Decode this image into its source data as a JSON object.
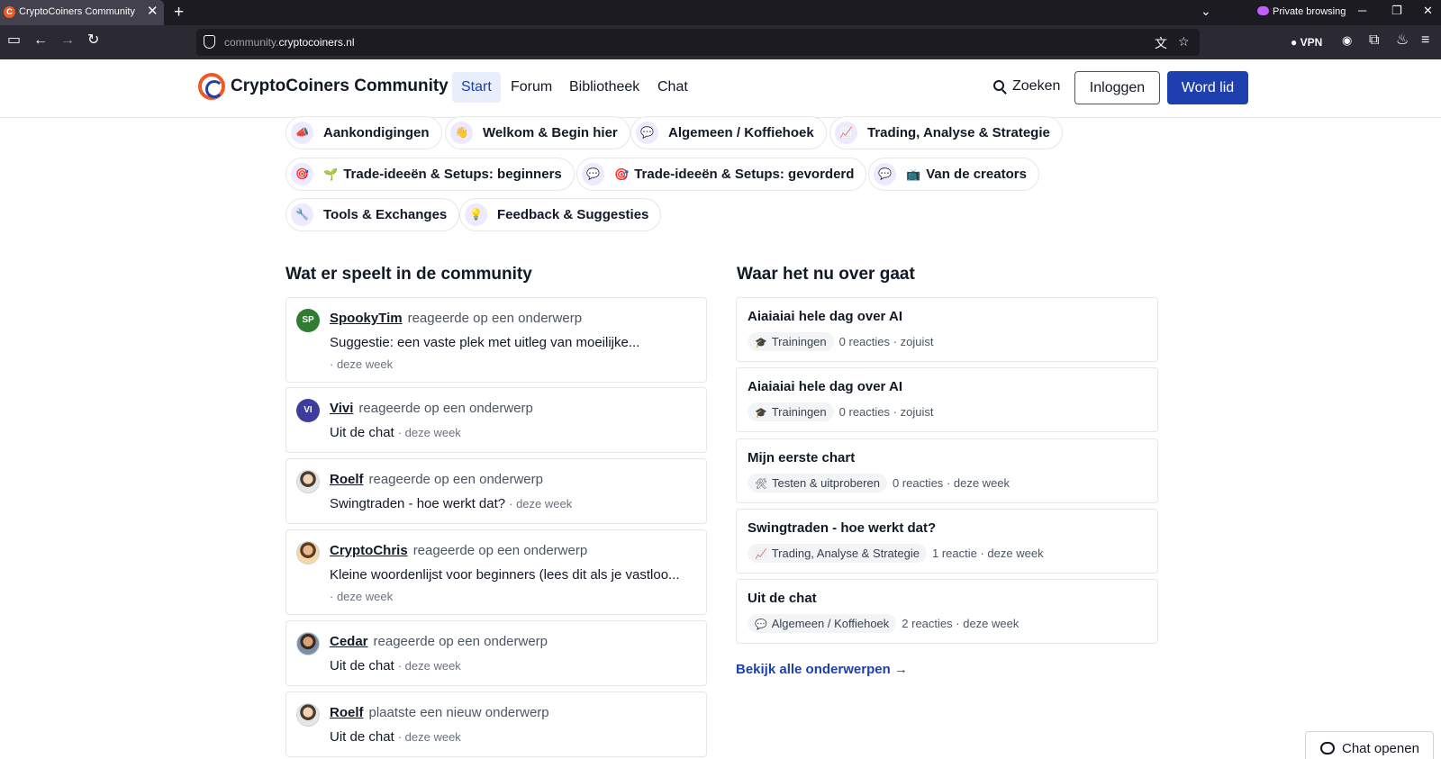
{
  "browser": {
    "tab_title": "CryptoCoiners Community",
    "tab_close": "✕",
    "new_tab": "+",
    "private_label": "Private browsing",
    "url_prefix": "community.",
    "url_domain": "cryptocoiners.nl",
    "vpn_label": "VPN"
  },
  "site": {
    "name": "CryptoCoiners Community",
    "nav": [
      {
        "label": "Start",
        "active": true
      },
      {
        "label": "Forum"
      },
      {
        "label": "Bibliotheek"
      },
      {
        "label": "Chat"
      }
    ],
    "search_label": "Zoeken",
    "login_label": "Inloggen",
    "join_label": "Word lid"
  },
  "categories": [
    {
      "icon": "megaphone-icon",
      "label": "Aankondigingen"
    },
    {
      "icon": "wave-hand-icon",
      "label": "Welkom & Begin hier"
    },
    {
      "icon": "speech-bubble-icon",
      "label": "Algemeen / Koffiehoek"
    },
    {
      "icon": "chart-up-icon",
      "label": "Trading, Analyse & Strategie"
    },
    {
      "icon": "target-icon",
      "emoji": "seedling-icon",
      "label": "Trade-ideeën & Setups: beginners"
    },
    {
      "icon": "speech-bubble-icon",
      "emoji": "target-icon",
      "label": "Trade-ideeën & Setups: gevorderd"
    },
    {
      "icon": "speech-bubble-icon",
      "emoji": "tv-icon",
      "label": "Van de creators"
    },
    {
      "icon": "wrench-icon",
      "label": "Tools & Exchanges"
    },
    {
      "icon": "lightbulb-icon",
      "label": "Feedback & Suggesties"
    }
  ],
  "activity": {
    "title": "Wat er speelt in de community",
    "items": [
      {
        "user": "SpookyTim",
        "initials": "SP",
        "avatar_color": "#2e7d32",
        "action": "reageerde op een onderwerp",
        "topic": "Suggestie: een vaste plek met uitleg van moeilijke...",
        "time": "· deze week"
      },
      {
        "user": "Vivi",
        "initials": "VI",
        "avatar_color": "#3f3d9b",
        "action": "reageerde op een onderwerp",
        "topic": "Uit de chat",
        "time": "· deze week"
      },
      {
        "user": "Roelf",
        "initials": "",
        "action": "reageerde op een onderwerp",
        "topic": "Swingtraden - hoe werkt dat?",
        "time": "· deze week"
      },
      {
        "user": "CryptoChris",
        "initials": "",
        "action": "reageerde op een onderwerp",
        "topic": "Kleine woordenlijst voor beginners (lees dit als je vastloo...",
        "time": "· deze week"
      },
      {
        "user": "Cedar",
        "initials": "",
        "action": "reageerde op een onderwerp",
        "topic": "Uit de chat",
        "time": "· deze week"
      },
      {
        "user": "Roelf",
        "initials": "",
        "action": "plaatste een nieuw onderwerp",
        "topic": "Uit de chat",
        "time": "· deze week"
      }
    ]
  },
  "topics": {
    "title": "Waar het nu over gaat",
    "items": [
      {
        "title": "Aiaiaiai hele dag over AI",
        "category": "Trainingen",
        "category_icon": "graduation-cap-icon",
        "replies": "0 reacties",
        "time": "· zojuist"
      },
      {
        "title": "Aiaiaiai hele dag over AI",
        "category": "Trainingen",
        "category_icon": "graduation-cap-icon",
        "replies": "0 reacties",
        "time": "· zojuist"
      },
      {
        "title": "Mijn eerste chart",
        "category": "Testen & uitproberen",
        "category_icon": "tools-icon",
        "replies": "0 reacties",
        "time": "· deze week"
      },
      {
        "title": "Swingtraden - hoe werkt dat?",
        "category": "Trading, Analyse & Strategie",
        "category_icon": "chart-up-icon",
        "replies": "1 reactie",
        "time": "· deze week"
      },
      {
        "title": "Uit de chat",
        "category": "Algemeen / Koffiehoek",
        "category_icon": "speech-bubble-icon",
        "replies": "2 reacties",
        "time": "· deze week"
      }
    ],
    "view_all": "Bekijk alle onderwerpen →"
  },
  "chat_widget": {
    "label": "Chat openen"
  }
}
